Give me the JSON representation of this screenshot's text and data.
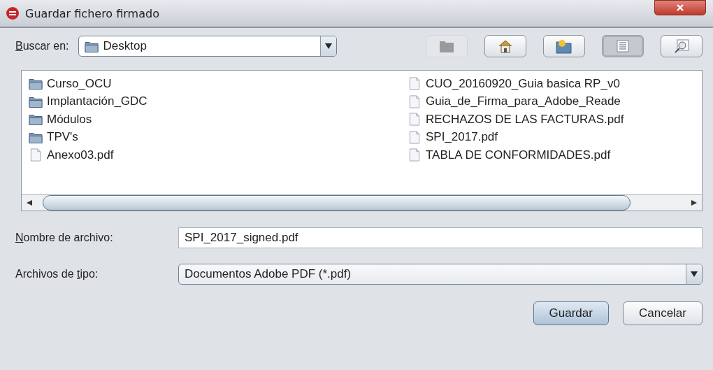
{
  "window": {
    "title": "Guardar fichero firmado"
  },
  "look_in": {
    "label_key": "B",
    "label_end": "uscar en:",
    "value": "Desktop"
  },
  "toolbar": [
    {
      "kind": "up",
      "disabled": true,
      "selected": false
    },
    {
      "kind": "home",
      "disabled": false,
      "selected": false
    },
    {
      "kind": "newfolder",
      "disabled": false,
      "selected": false
    },
    {
      "kind": "list",
      "disabled": false,
      "selected": true
    },
    {
      "kind": "details",
      "disabled": false,
      "selected": false
    }
  ],
  "files": {
    "columns": [
      [
        {
          "name": "Curso_OCU",
          "kind": "folder"
        },
        {
          "name": "Implantación_GDC",
          "kind": "folder"
        },
        {
          "name": "Módulos",
          "kind": "folder"
        },
        {
          "name": "TPV's",
          "kind": "folder"
        },
        {
          "name": "Anexo03.pdf",
          "kind": "file"
        }
      ],
      [
        {
          "name": "CUO_20160920_Guia basica RP_v0",
          "kind": "file"
        },
        {
          "name": "Guia_de_Firma_para_Adobe_Reade",
          "kind": "file"
        },
        {
          "name": "RECHAZOS DE LAS FACTURAS.pdf",
          "kind": "file"
        },
        {
          "name": "SPI_2017.pdf",
          "kind": "file"
        },
        {
          "name": "TABLA DE CONFORMIDADES.pdf",
          "kind": "file"
        }
      ]
    ]
  },
  "file_name": {
    "label_key": "N",
    "label_end": "ombre de archivo:",
    "value": "SPI_2017_signed.pdf"
  },
  "file_type": {
    "label_start": "Archivos de ",
    "label_key": "t",
    "label_end": "ipo:",
    "value": "Documentos Adobe PDF (*.pdf)"
  },
  "buttons": [
    {
      "label": "Guardar",
      "kind": "primary"
    },
    {
      "label": "Cancelar",
      "kind": "normal"
    }
  ]
}
